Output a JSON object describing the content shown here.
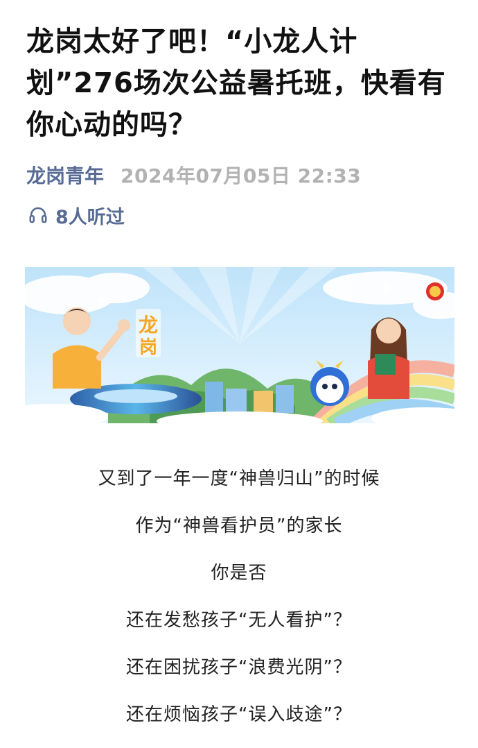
{
  "article": {
    "title": "龙岗太好了吧！“小龙人计划”276场次公益暑托班，快看有你心动的吗？",
    "account_name": "龙岗青年",
    "publish_time": "2024年07月05日 22:33",
    "listen_count": "8人听过",
    "listen_icon": "headphones-icon",
    "banner": {
      "logo_text_top": "龙",
      "logo_text_bottom": "岗",
      "badge_icon": "youth-league-badge-icon"
    },
    "body_lines": [
      "又到了一年一度“神兽归山”的时候",
      "作为“神兽看护员”的家长",
      "你是否",
      "还在发愁孩子“无人看护”？",
      "还在困扰孩子“浪费光阴”？",
      "还在烦恼孩子“误入歧途”？"
    ]
  },
  "colors": {
    "account_link": "#576b95",
    "time_gray": "#b2b2b2",
    "title": "#111111",
    "banner_sky": "#cfeafb",
    "logo_orange": "#f5a623"
  }
}
